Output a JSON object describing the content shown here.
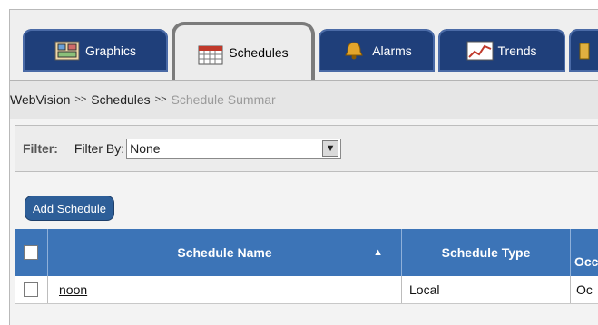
{
  "tabs": [
    {
      "label": "Graphics",
      "icon": "graphics-icon"
    },
    {
      "label": "Schedules",
      "icon": "calendar-icon",
      "active": true
    },
    {
      "label": "Alarms",
      "icon": "bell-icon"
    },
    {
      "label": "Trends",
      "icon": "trend-chart-icon"
    },
    {
      "label": "",
      "icon": "more-icon"
    }
  ],
  "breadcrumb": {
    "items": [
      "WebVision",
      "Schedules",
      "Schedule Summar"
    ],
    "separator": ">>"
  },
  "filter": {
    "label": "Filter:",
    "by_label": "Filter By:",
    "selected": "None",
    "dropdown_glyph": "▼"
  },
  "add_button": "Add Schedule",
  "table": {
    "columns": {
      "name": "Schedule Name",
      "sort_glyph": "▲",
      "type": "Schedule Type",
      "occ": "Occ"
    },
    "rows": [
      {
        "name": "noon",
        "type": "Local",
        "occ": "Oc"
      }
    ]
  }
}
